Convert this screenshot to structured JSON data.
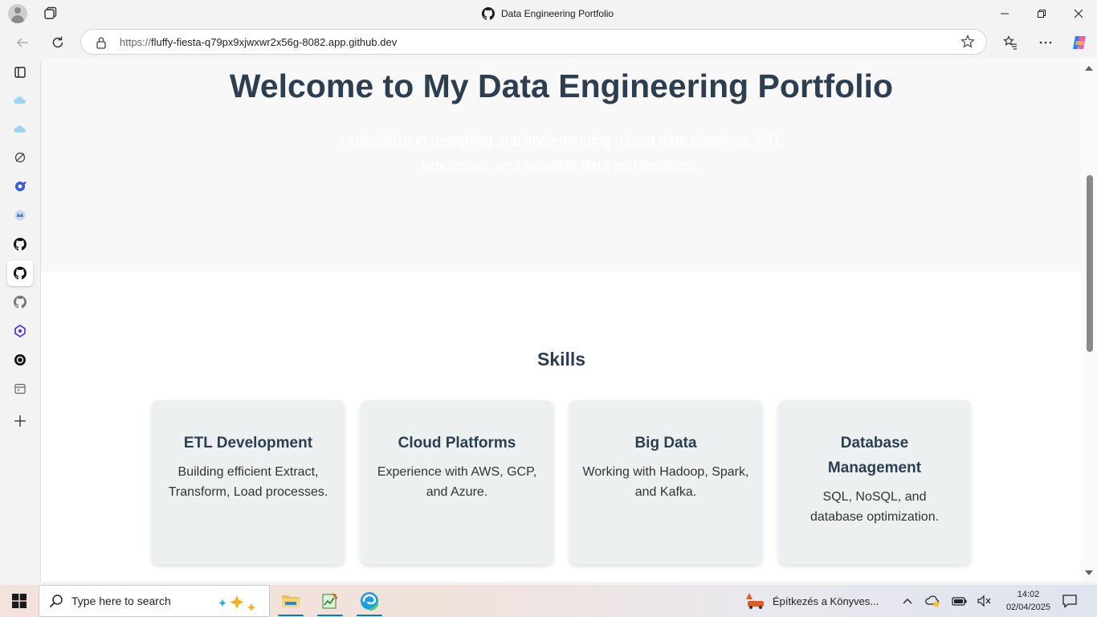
{
  "window": {
    "title": "Data Engineering Portfolio"
  },
  "address_bar": {
    "url_scheme": "https://",
    "url_host": "fluffy-fiesta-q79px9xjwxwr2x56g-8082.app.github.dev"
  },
  "sidebar": {
    "items": [
      "collections-icon",
      "cloud-icon",
      "cloud-icon",
      "compass-icon",
      "shortcut-icon",
      "crown-icon",
      "github-icon",
      "github-icon",
      "github-icon",
      "perplexity-icon",
      "openai-icon",
      "calendar-icon",
      "add-icon"
    ]
  },
  "page": {
    "hero": {
      "title": "Welcome to My Data Engineering Portfolio",
      "subtitle": "I specialize in designing and implementing robust data pipelines, ETL processes, and scalable data architectures."
    },
    "skills": {
      "title": "Skills",
      "cards": [
        {
          "title": "ETL Development",
          "text": "Building efficient Extract, Transform, Load processes."
        },
        {
          "title": "Cloud Platforms",
          "text": "Experience with AWS, GCP, and Azure."
        },
        {
          "title": "Big Data",
          "text": "Working with Hadoop, Spark, and Kafka."
        },
        {
          "title": "Database Management",
          "text": "SQL, NoSQL, and database optimization."
        }
      ]
    }
  },
  "taskbar": {
    "search_placeholder": "Type here to search",
    "notification_text": "Építkezés a Könyves...",
    "time": "14:02",
    "date": "02/04/2025"
  },
  "colors": {
    "heading": "#2c3e50",
    "card_bg": "#ecf0f1",
    "hero_bg": "#f8f8f8",
    "accent": "#0078d4"
  }
}
